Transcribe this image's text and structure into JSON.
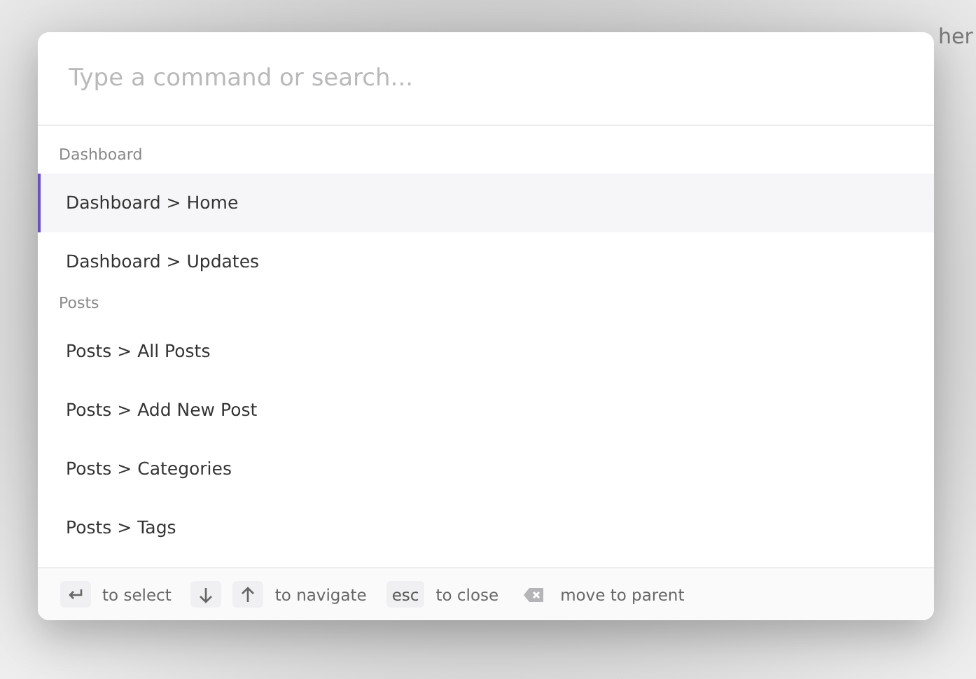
{
  "background": {
    "text": "her"
  },
  "search": {
    "placeholder": "Type a command or search..."
  },
  "groups": [
    {
      "heading": "Dashboard",
      "items": [
        {
          "label": "Dashboard > Home",
          "selected": true
        },
        {
          "label": "Dashboard > Updates",
          "selected": false
        }
      ]
    },
    {
      "heading": "Posts",
      "items": [
        {
          "label": "Posts > All Posts",
          "selected": false
        },
        {
          "label": "Posts > Add New Post",
          "selected": false
        },
        {
          "label": "Posts > Categories",
          "selected": false
        },
        {
          "label": "Posts > Tags",
          "selected": false
        }
      ]
    }
  ],
  "footer": [
    {
      "keys": [
        {
          "kind": "enter"
        }
      ],
      "text": "to select"
    },
    {
      "keys": [
        {
          "kind": "down"
        },
        {
          "kind": "up"
        }
      ],
      "text": "to navigate"
    },
    {
      "keys": [
        {
          "kind": "text",
          "label": "esc"
        }
      ],
      "text": "to close"
    },
    {
      "keys": [
        {
          "kind": "backspace"
        }
      ],
      "text": "move to parent"
    }
  ]
}
